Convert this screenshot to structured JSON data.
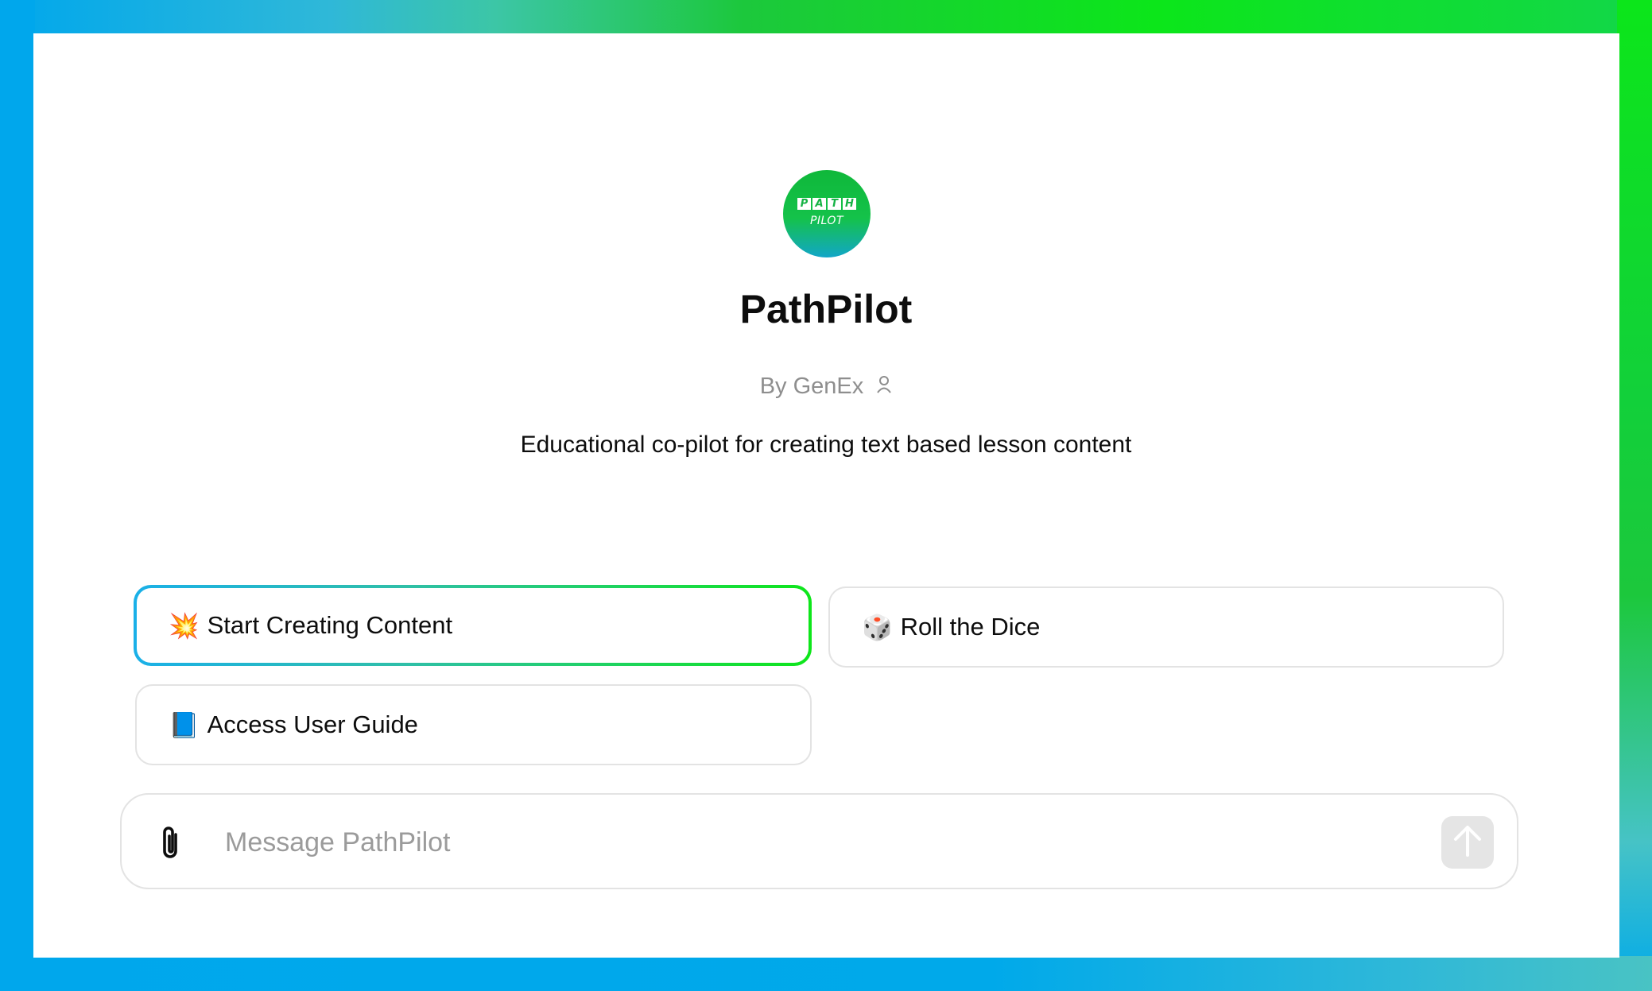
{
  "app": {
    "name": "PathPilot",
    "author": "By GenEx",
    "description": "Educational co-pilot for creating text based lesson content",
    "logo": {
      "top_letters": [
        "P",
        "A",
        "T",
        "H"
      ],
      "bottom_text": "PILOT"
    }
  },
  "starters": [
    {
      "emoji": "💥",
      "label": "Start Creating Content"
    },
    {
      "emoji": "🎲",
      "label": "Roll the Dice"
    },
    {
      "emoji": "📘",
      "label": "Access User Guide"
    }
  ],
  "composer": {
    "placeholder": "Message PathPilot"
  },
  "colors": {
    "accent_green": "#0ee61a",
    "accent_blue": "#00a7ec"
  },
  "icons": {
    "attach": "paperclip-icon",
    "send": "arrow-up-icon",
    "author": "person-icon"
  }
}
